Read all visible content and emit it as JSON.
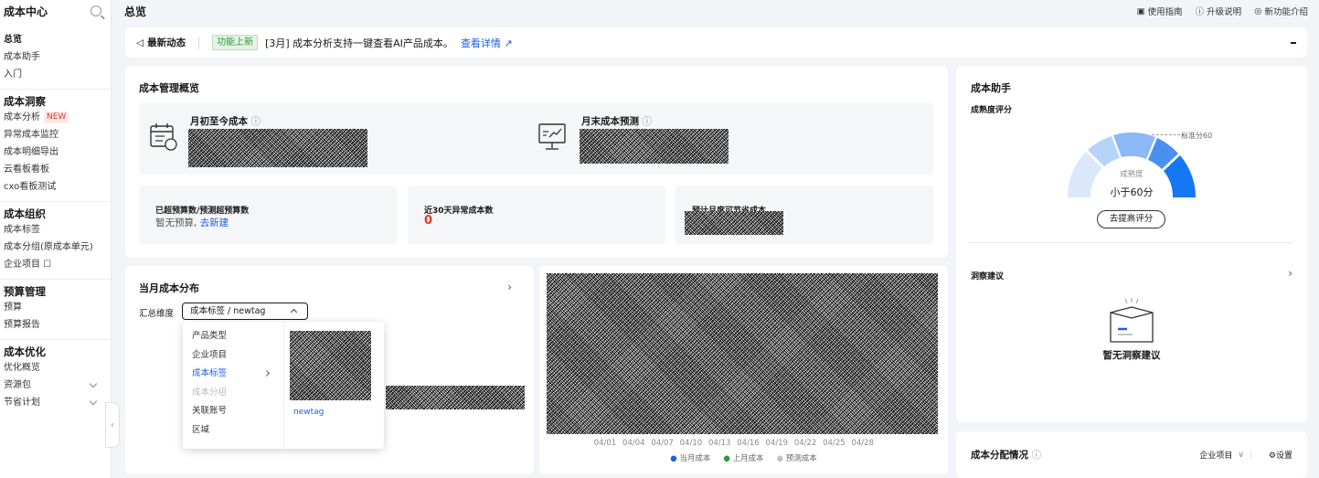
{
  "sidebar": {
    "title": "成本中心",
    "items_top": [
      "总览",
      "成本助手",
      "入门"
    ],
    "groups": [
      {
        "title": "成本洞察",
        "items": [
          {
            "label": "成本分析",
            "badge": "NEW"
          },
          {
            "label": "异常成本监控"
          },
          {
            "label": "成本明细导出"
          },
          {
            "label": "云看板看板"
          },
          {
            "label": "cxo看板测试"
          }
        ]
      },
      {
        "title": "成本组织",
        "items": [
          {
            "label": "成本标签"
          },
          {
            "label": "成本分组(原成本单元)"
          },
          {
            "label": "企业项目 ☐"
          }
        ]
      },
      {
        "title": "预算管理",
        "items": [
          {
            "label": "预算"
          },
          {
            "label": "预算报告"
          }
        ]
      },
      {
        "title": "成本优化",
        "items": [
          {
            "label": "优化概览"
          },
          {
            "label": "资源包"
          },
          {
            "label": "节省计划"
          }
        ]
      }
    ]
  },
  "topbar": {
    "title": "总览",
    "links": [
      "使用指南",
      "升级说明",
      "新功能介绍"
    ]
  },
  "news": {
    "label": "最新动态",
    "tag": "功能上新",
    "text": "[3月] 成本分析支持一键查看AI产品成本。",
    "link": "查看详情"
  },
  "overview": {
    "title": "成本管理概览",
    "mtd_label": "月初至今成本",
    "forecast_label": "月末成本预测",
    "budget_label": "已超预算数/预测超预算数",
    "budget_text": "暂无预算,",
    "budget_link": "去新建",
    "anomaly_label": "近30天异常成本数",
    "anomaly_value": "0",
    "saving_label": "预计月度可节省成本"
  },
  "distribution": {
    "title": "当月成本分布",
    "dim_label": "汇总维度",
    "dim_value": "成本标签 / newtag",
    "options": [
      "产品类型",
      "企业项目",
      "成本标签",
      "成本分组",
      "关联账号",
      "区域"
    ],
    "selected": "成本标签",
    "sub_option": "newtag"
  },
  "trend": {
    "x_ticks": [
      "04/01",
      "04/04",
      "04/07",
      "04/10",
      "04/13",
      "04/16",
      "04/19",
      "04/22",
      "04/25",
      "04/28"
    ],
    "legend": [
      {
        "name": "当月成本",
        "color": "#1a5ee6"
      },
      {
        "name": "上月成本",
        "color": "#2a9a3a"
      },
      {
        "name": "预测成本",
        "color": "#c2c2c2"
      }
    ]
  },
  "assistant": {
    "title": "成本助手",
    "maturity_label": "成熟度评分",
    "benchmark": "标准分60",
    "gauge_caption": "成熟度",
    "gauge_value": "小于60分",
    "button": "去提高评分",
    "insight_title": "洞察建议",
    "empty_text": "暂无洞察建议"
  },
  "allocation": {
    "title": "成本分配情况",
    "select": "企业项目",
    "settings": "设置"
  }
}
